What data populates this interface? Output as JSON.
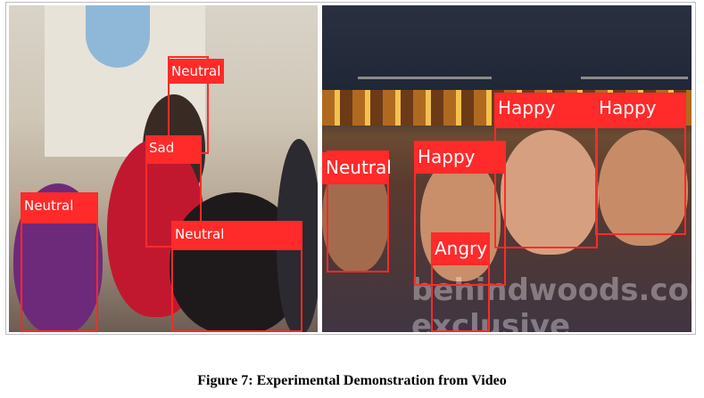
{
  "figure": {
    "caption": "Figure 7: Experimental Demonstration from Video",
    "left_panel": {
      "detections": [
        {
          "emotion": "Neutral"
        },
        {
          "emotion": "Sad"
        },
        {
          "emotion": "Neutral"
        },
        {
          "emotion": "Neutral"
        }
      ]
    },
    "right_panel": {
      "watermark": "behindwoods.com exclusive",
      "detections": [
        {
          "emotion": "Neutral"
        },
        {
          "emotion": "Happy"
        },
        {
          "emotion": "Angry"
        },
        {
          "emotion": "Happy"
        },
        {
          "emotion": "Happy"
        }
      ]
    },
    "box_color": "#ff2a2a"
  }
}
